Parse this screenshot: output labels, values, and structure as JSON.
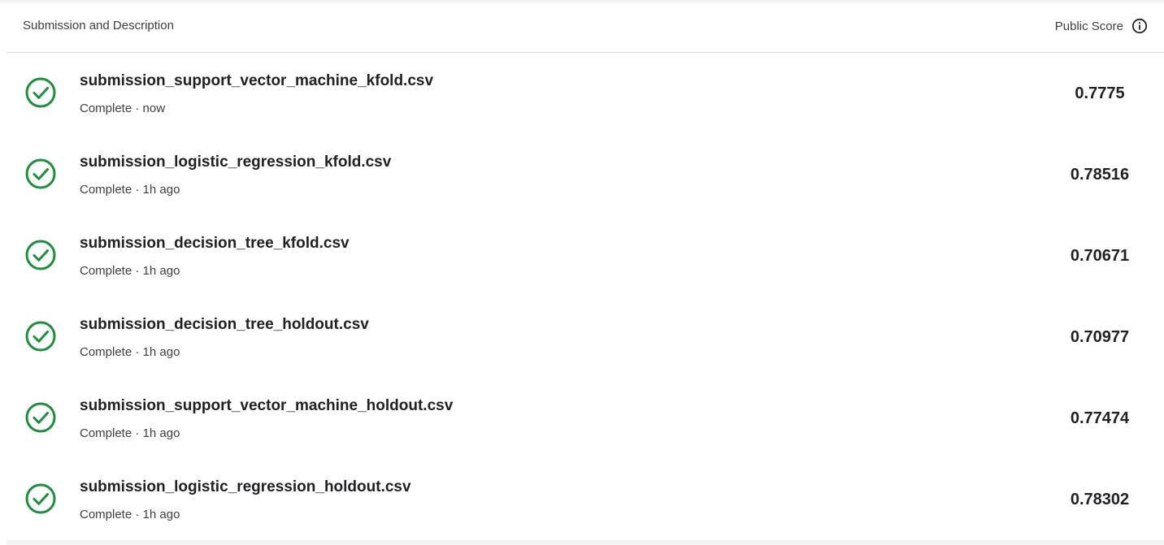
{
  "header": {
    "left_label": "Submission and Description",
    "right_label": "Public Score",
    "info_icon": "info-circle-icon"
  },
  "status_icon": "check-circle-icon",
  "colors": {
    "success": "#1e8e3e",
    "text_primary": "#202124",
    "text_secondary": "#3c4043",
    "divider": "#dadce0"
  },
  "submissions": [
    {
      "file": "submission_support_vector_machine_kfold.csv",
      "meta": "Complete · now",
      "score": "0.7775"
    },
    {
      "file": "submission_logistic_regression_kfold.csv",
      "meta": "Complete · 1h ago",
      "score": "0.78516"
    },
    {
      "file": "submission_decision_tree_kfold.csv",
      "meta": "Complete · 1h ago",
      "score": "0.70671"
    },
    {
      "file": "submission_decision_tree_holdout.csv",
      "meta": "Complete · 1h ago",
      "score": "0.70977"
    },
    {
      "file": "submission_support_vector_machine_holdout.csv",
      "meta": "Complete · 1h ago",
      "score": "0.77474"
    },
    {
      "file": "submission_logistic_regression_holdout.csv",
      "meta": "Complete · 1h ago",
      "score": "0.78302"
    }
  ]
}
